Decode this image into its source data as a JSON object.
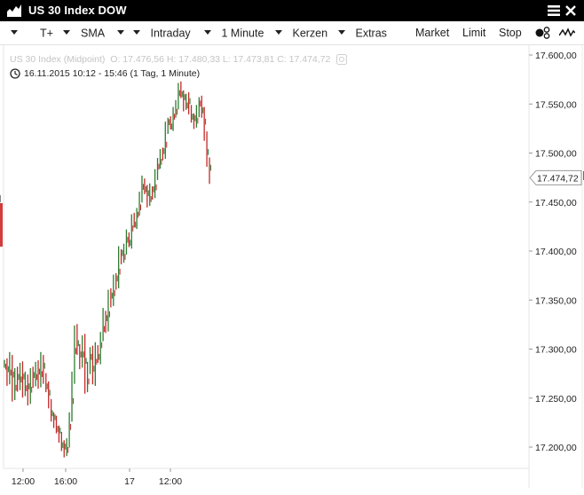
{
  "window": {
    "title": "US 30 Index DOW"
  },
  "toolbar": {
    "items": [
      {
        "label": "",
        "has_caret": true
      },
      {
        "label": "T+",
        "has_caret": true
      },
      {
        "label": "SMA",
        "has_caret": true
      },
      {
        "label": "Intraday",
        "has_caret": true
      },
      {
        "label": "1 Minute",
        "has_caret": true
      },
      {
        "label": "Kerzen",
        "has_caret": true
      },
      {
        "label": "Extras",
        "has_caret": false
      }
    ],
    "market": "Market",
    "limit": "Limit",
    "stop": "Stop"
  },
  "header": {
    "instrument": "US 30 Index (Midpoint)",
    "ohlc": "O: 17.476,56  H: 17.480,33  L: 17.473,81  C: 17.474,72",
    "range": "16.11.2015 10:12 - 15:46 (1 Tag, 1 Minute)"
  },
  "colors": {
    "up": "#2e7d32",
    "down": "#c62828",
    "title_bg": "#000000",
    "label_border": "#9a9a9a"
  },
  "chart_data": {
    "type": "line",
    "y_ticks": [
      "17.600,00",
      "17.550,00",
      "17.500,00",
      "17.450,00",
      "17.400,00",
      "17.350,00",
      "17.300,00",
      "17.250,00",
      "17.200,00"
    ],
    "y_tick_values": [
      17600,
      17550,
      17500,
      17450,
      17400,
      17350,
      17300,
      17250,
      17200
    ],
    "ylim": [
      17180,
      17622
    ],
    "x_ticks": [
      "12:00",
      "16:00",
      "17",
      "12:00"
    ],
    "last_price_label": "17.474,72",
    "last_price": 17474.72,
    "series": [
      {
        "values": [
          17285,
          17268,
          17290,
          17252,
          17275,
          17262,
          17282,
          17256,
          17270,
          17248,
          17275,
          17266,
          17283,
          17265,
          17290,
          17270,
          17260,
          17245,
          17230,
          17225,
          17218,
          17210,
          17200,
          17195,
          17205,
          17230,
          17270,
          17320,
          17298,
          17285,
          17310,
          17260,
          17280,
          17298,
          17268,
          17300,
          17290,
          17312,
          17335,
          17322,
          17355,
          17348,
          17372,
          17366,
          17398,
          17392,
          17402,
          17415,
          17408,
          17432,
          17428,
          17440,
          17455,
          17470,
          17462,
          17450,
          17462,
          17458,
          17478,
          17488,
          17500,
          17498,
          17525,
          17532,
          17528,
          17540,
          17550,
          17566,
          17560,
          17548,
          17555,
          17545,
          17535,
          17530,
          17542,
          17553,
          17540,
          17518,
          17490,
          17474
        ]
      }
    ]
  }
}
